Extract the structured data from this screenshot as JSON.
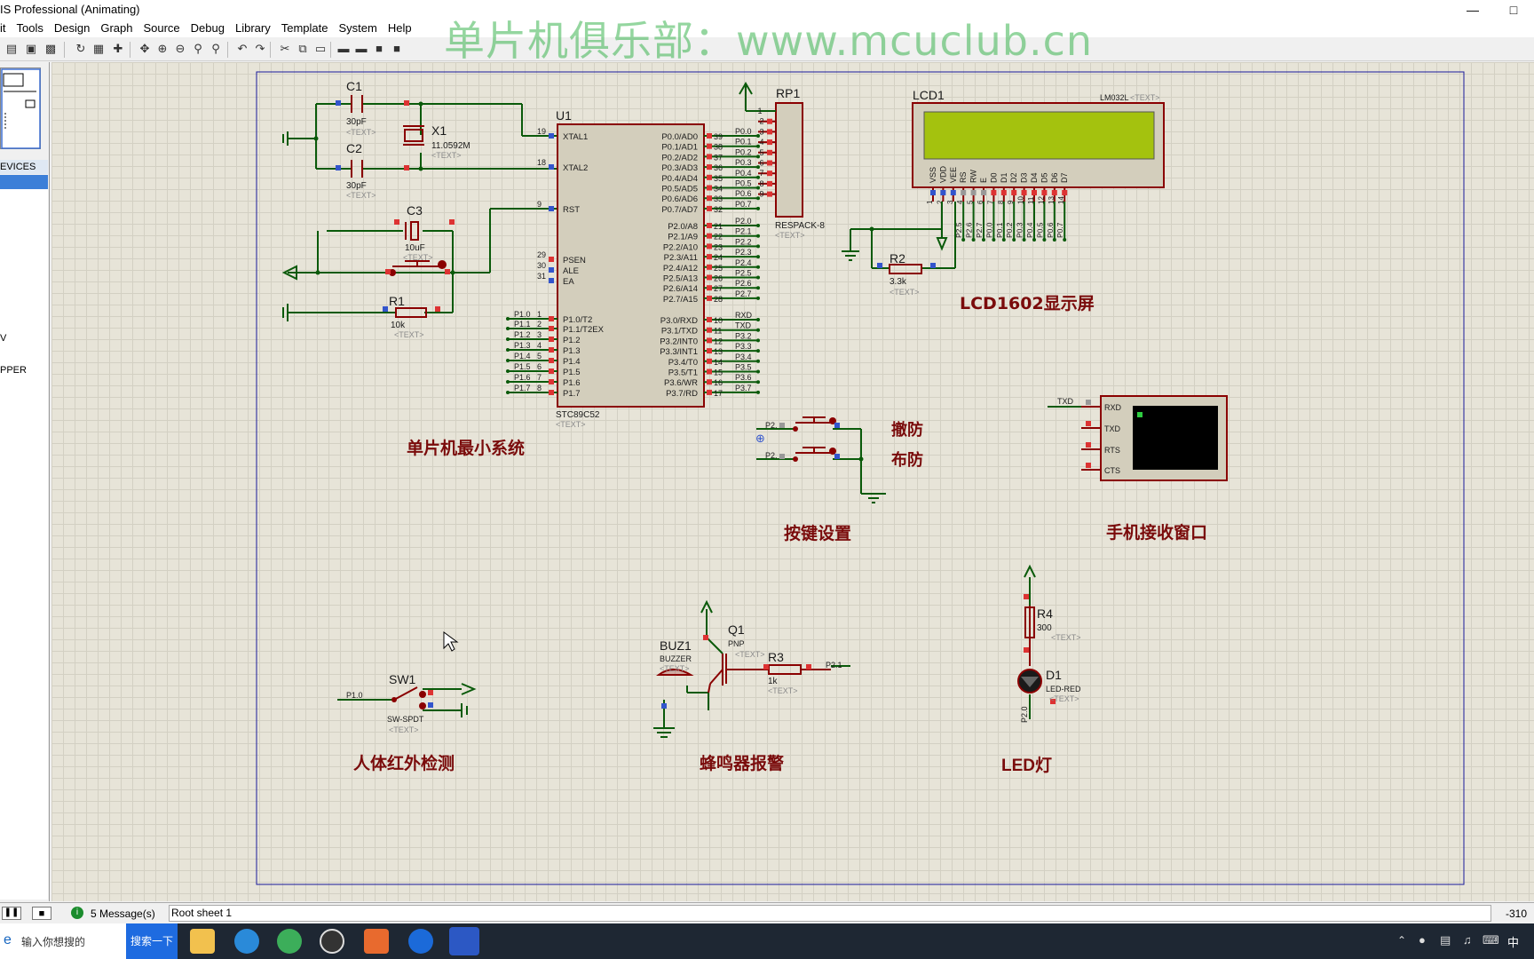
{
  "titlebar": {
    "title": "IS Professional (Animating)"
  },
  "menu": [
    "it",
    "Tools",
    "Design",
    "Graph",
    "Source",
    "Debug",
    "Library",
    "Template",
    "System",
    "Help"
  ],
  "watermark": "单片机俱乐部：www.mcuclub.cn",
  "left_panel": {
    "devices_header": "EVICES",
    "items": [
      "V",
      "PPER"
    ]
  },
  "status": {
    "messages": "5 Message(s)",
    "sheet": "Root sheet 1",
    "coord": "-310"
  },
  "taskbar": {
    "search_placeholder": "输入你想搜的",
    "search_button": "搜索一下",
    "ime": "中"
  },
  "schematic": {
    "c1": {
      "ref": "C1",
      "value": "30pF",
      "text": "<TEXT>"
    },
    "c2": {
      "ref": "C2",
      "value": "30pF",
      "text": "<TEXT>"
    },
    "x1": {
      "ref": "X1",
      "value": "11.0592M",
      "text": "<TEXT>"
    },
    "c3": {
      "ref": "C3",
      "value": "10uF",
      "text": "<TEXT>"
    },
    "r1": {
      "ref": "R1",
      "value": "10k",
      "text": "<TEXT>"
    },
    "u1": {
      "ref": "U1",
      "part": "STC89C52",
      "text": "<TEXT>",
      "left_pins": [
        {
          "num": "19",
          "name": "XTAL1"
        },
        {
          "num": "18",
          "name": "XTAL2"
        },
        {
          "num": "9",
          "name": "RST"
        },
        {
          "num": "29",
          "name": "PSEN"
        },
        {
          "num": "30",
          "name": "ALE"
        },
        {
          "num": "31",
          "name": "EA"
        },
        {
          "num": "1",
          "name": "P1.0/T2"
        },
        {
          "num": "2",
          "name": "P1.1/T2EX"
        },
        {
          "num": "3",
          "name": "P1.2"
        },
        {
          "num": "4",
          "name": "P1.3"
        },
        {
          "num": "5",
          "name": "P1.4"
        },
        {
          "num": "6",
          "name": "P1.5"
        },
        {
          "num": "7",
          "name": "P1.6"
        },
        {
          "num": "8",
          "name": "P1.7"
        }
      ],
      "left_nets": [
        "P1.0",
        "P1.1",
        "P1.2",
        "P1.3",
        "P1.4",
        "P1.5",
        "P1.6",
        "P1.7"
      ],
      "right_pins": [
        {
          "num": "39",
          "name": "P0.0/AD0",
          "net": "P0.0"
        },
        {
          "num": "38",
          "name": "P0.1/AD1",
          "net": "P0.1"
        },
        {
          "num": "37",
          "name": "P0.2/AD2",
          "net": "P0.2"
        },
        {
          "num": "36",
          "name": "P0.3/AD3",
          "net": "P0.3"
        },
        {
          "num": "35",
          "name": "P0.4/AD4",
          "net": "P0.4"
        },
        {
          "num": "34",
          "name": "P0.5/AD5",
          "net": "P0.5"
        },
        {
          "num": "33",
          "name": "P0.6/AD6",
          "net": "P0.6"
        },
        {
          "num": "32",
          "name": "P0.7/AD7",
          "net": "P0.7"
        },
        {
          "num": "21",
          "name": "P2.0/A8",
          "net": "P2.0"
        },
        {
          "num": "22",
          "name": "P2.1/A9",
          "net": "P2.1"
        },
        {
          "num": "23",
          "name": "P2.2/A10",
          "net": "P2.2"
        },
        {
          "num": "24",
          "name": "P2.3/A11",
          "net": "P2.3"
        },
        {
          "num": "25",
          "name": "P2.4/A12",
          "net": "P2.4"
        },
        {
          "num": "26",
          "name": "P2.5/A13",
          "net": "P2.5"
        },
        {
          "num": "27",
          "name": "P2.6/A14",
          "net": "P2.6"
        },
        {
          "num": "28",
          "name": "P2.7/A15",
          "net": "P2.7"
        },
        {
          "num": "10",
          "name": "P3.0/RXD",
          "net": "RXD"
        },
        {
          "num": "11",
          "name": "P3.1/TXD",
          "net": "TXD"
        },
        {
          "num": "12",
          "name": "P3.2/INT0",
          "net": "P3.2"
        },
        {
          "num": "13",
          "name": "P3.3/INT1",
          "net": "P3.3"
        },
        {
          "num": "14",
          "name": "P3.4/T0",
          "net": "P3.4"
        },
        {
          "num": "15",
          "name": "P3.5/T1",
          "net": "P3.5"
        },
        {
          "num": "16",
          "name": "P3.6/WR",
          "net": "P3.6"
        },
        {
          "num": "17",
          "name": "P3.7/RD",
          "net": "P3.7"
        }
      ]
    },
    "rp1": {
      "ref": "RP1",
      "part": "RESPACK-8",
      "text": "<TEXT>",
      "pins": [
        "1",
        "2",
        "3",
        "4",
        "5",
        "6",
        "7",
        "8",
        "9"
      ]
    },
    "lcd1": {
      "ref": "LCD1",
      "part": "LM032L",
      "text": "<TEXT>",
      "pin_names": [
        "VSS",
        "VDD",
        "VEE",
        "RS",
        "RW",
        "E",
        "D0",
        "D1",
        "D2",
        "D3",
        "D4",
        "D5",
        "D6",
        "D7"
      ],
      "pin_nums": [
        "1",
        "2",
        "3",
        "4",
        "5",
        "6",
        "7",
        "8",
        "9",
        "10",
        "11",
        "12",
        "13",
        "14"
      ],
      "nets": [
        "P2.5",
        "P2.6",
        "P2.7",
        "P0.0",
        "P0.1",
        "P0.2",
        "P0.3",
        "P0.4",
        "P0.5",
        "P0.6",
        "P0.7"
      ]
    },
    "r2": {
      "ref": "R2",
      "value": "3.3k",
      "text": "<TEXT>"
    },
    "lcd_label": "LCD1602显示屏",
    "mcu_label": "单片机最小系统",
    "keys": {
      "net1": "P2.",
      "net2": "P2.",
      "label1": "撤防",
      "label2": "布防",
      "section": "按键设置"
    },
    "terminal": {
      "net": "TXD",
      "pins": [
        "RXD",
        "TXD",
        "RTS",
        "CTS"
      ],
      "section": "手机接收窗口"
    },
    "r4": {
      "ref": "R4",
      "value": "300",
      "text": "<TEXT>"
    },
    "d1": {
      "ref": "D1",
      "part": "LED-RED",
      "text": "<TEXT>",
      "net": "P2.0"
    },
    "led_label": "LED灯",
    "buz1": {
      "ref": "BUZ1",
      "part": "BUZZER",
      "text": "<TEXT>"
    },
    "q1": {
      "ref": "Q1",
      "part": "PNP",
      "text": "<TEXT>"
    },
    "r3": {
      "ref": "R3",
      "value": "1k",
      "text": "<TEXT>",
      "net": "P2.1"
    },
    "buzzer_label": "蜂鸣器报警",
    "sw1": {
      "ref": "SW1",
      "part": "SW-SPDT",
      "text": "<TEXT>",
      "net": "P1.0"
    },
    "pir_label": "人体红外检测"
  }
}
